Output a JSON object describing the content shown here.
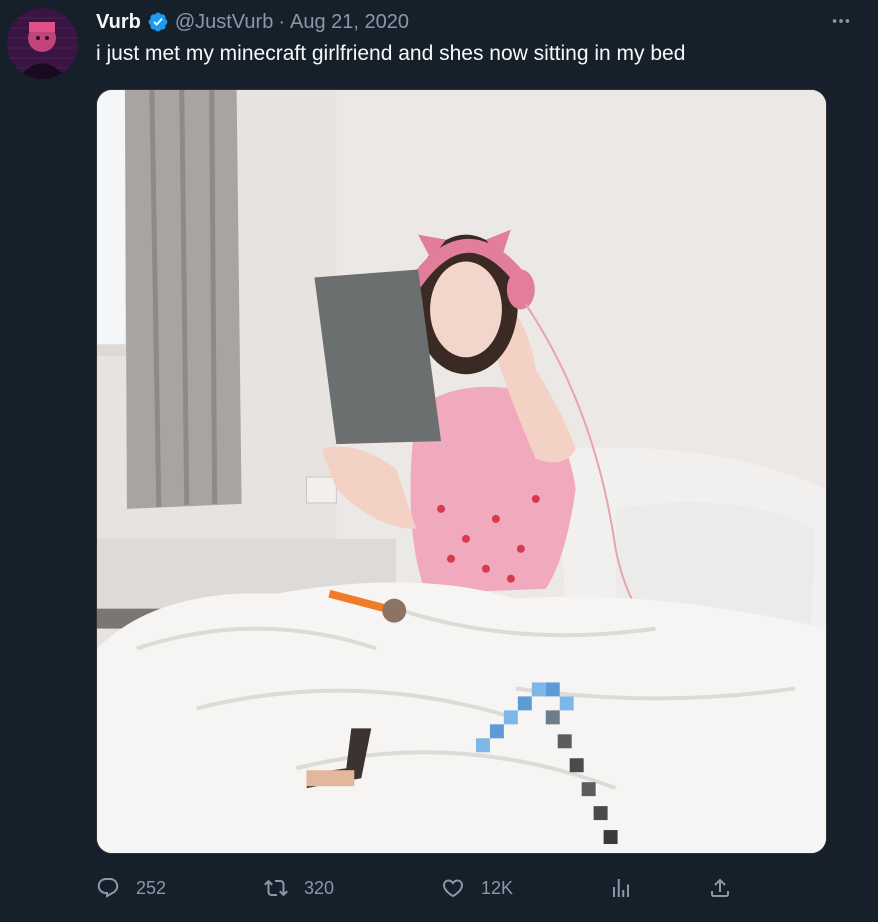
{
  "author": {
    "display_name": "Vurb",
    "handle": "@JustVurb",
    "separator": "·",
    "date": "Aug 21, 2020",
    "verified": true
  },
  "tweet_text": "i just met my minecraft girlfriend and shes now sitting in my bed",
  "icons": {
    "more": "more-options-icon",
    "reply": "reply-icon",
    "retweet": "retweet-icon",
    "like": "like-icon",
    "views": "views-icon",
    "share": "share-icon",
    "verified": "verified-badge-icon"
  },
  "actions": {
    "replies": "252",
    "retweets": "320",
    "likes": "12K"
  },
  "colors": {
    "background": "#15202b",
    "text_primary": "#f7f9f9",
    "text_secondary": "#8b98a5",
    "verified_blue": "#1d9bf0"
  }
}
